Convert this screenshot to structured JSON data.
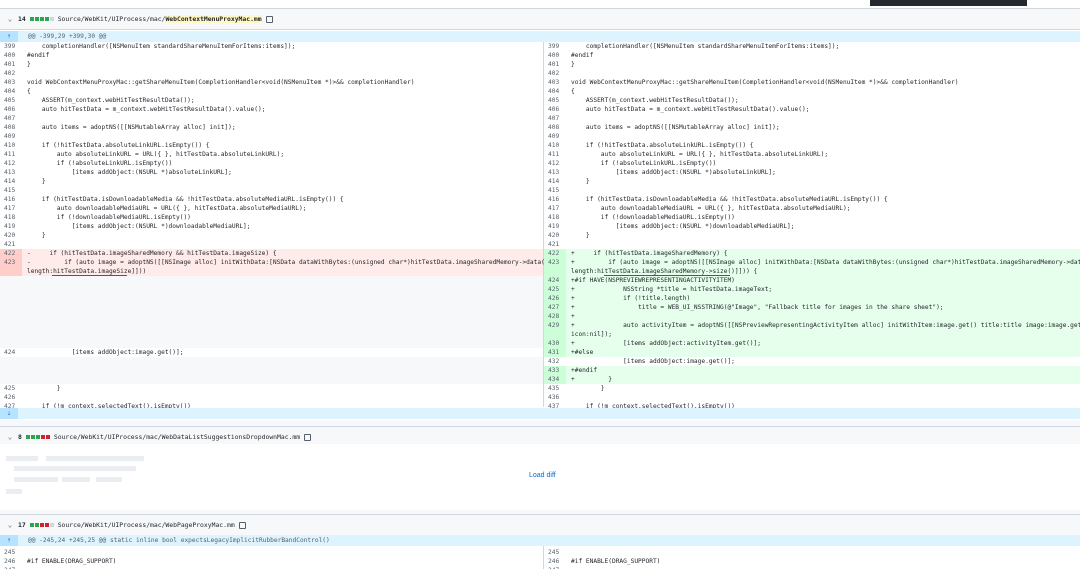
{
  "file1": {
    "count": "14",
    "path_prefix": "Source/WebKit/UIProcess/mac/",
    "path_file": "WebContextMenuProxyMac.mm",
    "hunk": "@@ -399,29 +399,30 @@"
  },
  "left_lines": [
    {
      "n": "399",
      "t": "    completionHandler([NSMenuItem standardShareMenuItemForItems:items]);"
    },
    {
      "n": "400",
      "t": "#endif"
    },
    {
      "n": "401",
      "t": "}"
    },
    {
      "n": "402",
      "t": ""
    },
    {
      "n": "403",
      "t": "void WebContextMenuProxyMac::getShareMenuItem(CompletionHandler<void(NSMenuItem *)>&& completionHandler)"
    },
    {
      "n": "404",
      "t": "{"
    },
    {
      "n": "405",
      "t": "    ASSERT(m_context.webHitTestResultData());"
    },
    {
      "n": "406",
      "t": "    auto hitTestData = m_context.webHitTestResultData().value();"
    },
    {
      "n": "407",
      "t": ""
    },
    {
      "n": "408",
      "t": "    auto items = adoptNS([[NSMutableArray alloc] init]);"
    },
    {
      "n": "409",
      "t": ""
    },
    {
      "n": "410",
      "t": "    if (!hitTestData.absoluteLinkURL.isEmpty()) {"
    },
    {
      "n": "411",
      "t": "        auto absoluteLinkURL = URL({ }, hitTestData.absoluteLinkURL);"
    },
    {
      "n": "412",
      "t": "        if (!absoluteLinkURL.isEmpty())"
    },
    {
      "n": "413",
      "t": "            [items addObject:(NSURL *)absoluteLinkURL];"
    },
    {
      "n": "414",
      "t": "    }"
    },
    {
      "n": "415",
      "t": ""
    },
    {
      "n": "416",
      "t": "    if (hitTestData.isDownloadableMedia && !hitTestData.absoluteMediaURL.isEmpty()) {"
    },
    {
      "n": "417",
      "t": "        auto downloadableMediaURL = URL({ }, hitTestData.absoluteMediaURL);"
    },
    {
      "n": "418",
      "t": "        if (!downloadableMediaURL.isEmpty())"
    },
    {
      "n": "419",
      "t": "            [items addObject:(NSURL *)downloadableMediaURL];"
    },
    {
      "n": "420",
      "t": "    }"
    },
    {
      "n": "421",
      "t": ""
    }
  ],
  "left_del": [
    {
      "n": "422",
      "t": "-     if (hitTestData.imageSharedMemory && hitTestData.imageSize) {"
    },
    {
      "n": "423",
      "t": "-         if (auto image = adoptNS([[NSImage alloc] initWithData:[NSData dataWithBytes:(unsigned char*)hitTestData.imageSharedMemory->data()"
    },
    {
      "n": "",
      "t": "length:hitTestData.imageSize]]))"
    }
  ],
  "left_tail": [
    {
      "n": "424",
      "t": "            [items addObject:image.get()];"
    },
    {
      "n": "425",
      "t": "        }"
    },
    {
      "n": "426",
      "t": ""
    },
    {
      "n": "427",
      "t": "    if (!m_context.selectedText().isEmpty())"
    }
  ],
  "right_lines": [
    {
      "n": "399",
      "t": "    completionHandler([NSMenuItem standardShareMenuItemForItems:items]);"
    },
    {
      "n": "400",
      "t": "#endif"
    },
    {
      "n": "401",
      "t": "}"
    },
    {
      "n": "402",
      "t": ""
    },
    {
      "n": "403",
      "t": "void WebContextMenuProxyMac::getShareMenuItem(CompletionHandler<void(NSMenuItem *)>&& completionHandler)"
    },
    {
      "n": "404",
      "t": "{"
    },
    {
      "n": "405",
      "t": "    ASSERT(m_context.webHitTestResultData());"
    },
    {
      "n": "406",
      "t": "    auto hitTestData = m_context.webHitTestResultData().value();"
    },
    {
      "n": "407",
      "t": ""
    },
    {
      "n": "408",
      "t": "    auto items = adoptNS([[NSMutableArray alloc] init]);"
    },
    {
      "n": "409",
      "t": ""
    },
    {
      "n": "410",
      "t": "    if (!hitTestData.absoluteLinkURL.isEmpty()) {"
    },
    {
      "n": "411",
      "t": "        auto absoluteLinkURL = URL({ }, hitTestData.absoluteLinkURL);"
    },
    {
      "n": "412",
      "t": "        if (!absoluteLinkURL.isEmpty())"
    },
    {
      "n": "413",
      "t": "            [items addObject:(NSURL *)absoluteLinkURL];"
    },
    {
      "n": "414",
      "t": "    }"
    },
    {
      "n": "415",
      "t": ""
    },
    {
      "n": "416",
      "t": "    if (hitTestData.isDownloadableMedia && !hitTestData.absoluteMediaURL.isEmpty()) {"
    },
    {
      "n": "417",
      "t": "        auto downloadableMediaURL = URL({ }, hitTestData.absoluteMediaURL);"
    },
    {
      "n": "418",
      "t": "        if (!downloadableMediaURL.isEmpty())"
    },
    {
      "n": "419",
      "t": "            [items addObject:(NSURL *)downloadableMediaURL];"
    },
    {
      "n": "420",
      "t": "    }"
    },
    {
      "n": "421",
      "t": ""
    }
  ],
  "right_add": [
    {
      "n": "422",
      "t": "+     if (hitTestData.imageSharedMemory) {"
    },
    {
      "n": "423",
      "t": "+         if (auto image = adoptNS([[NSImage alloc] initWithData:[NSData dataWithBytes:(unsigned char*)hitTestData.imageSharedMemory->data()"
    },
    {
      "n": "",
      "t": "length:hitTestData.imageSharedMemory->size()]])) {"
    },
    {
      "n": "424",
      "t": "+#if HAVE(NSPREVIEWREPRESENTINGACTIVITYITEM)"
    },
    {
      "n": "425",
      "t": "+             NSString *title = hitTestData.imageText;"
    },
    {
      "n": "426",
      "t": "+             if (!title.length)"
    },
    {
      "n": "427",
      "t": "+                 title = WEB_UI_NSSTRING(@\"Image\", \"Fallback title for images in the share sheet\");"
    },
    {
      "n": "428",
      "t": "+"
    },
    {
      "n": "429",
      "t": "+             auto activityItem = adoptNS([[NSPreviewRepresentingActivityItem alloc] initWithItem:image.get() title:title image:image.get()"
    },
    {
      "n": "",
      "t": "icon:nil]);"
    },
    {
      "n": "430",
      "t": "+             [items addObject:activityItem.get()];"
    },
    {
      "n": "431",
      "t": "+#else"
    },
    {
      "n": "432",
      "t": "              [items addObject:image.get()];"
    },
    {
      "n": "433",
      "t": "+#endif"
    },
    {
      "n": "434",
      "t": "+         }"
    }
  ],
  "right_tail": [
    {
      "n": "435",
      "t": "        }"
    },
    {
      "n": "436",
      "t": ""
    },
    {
      "n": "437",
      "t": "    if (!m_context.selectedText().isEmpty())"
    }
  ],
  "file2": {
    "count": "8",
    "path": "Source/WebKit/UIProcess/mac/WebDataListSuggestionsDropdownMac.mm",
    "load": "Load diff"
  },
  "file3": {
    "count": "17",
    "path": "Source/WebKit/UIProcess/mac/WebPageProxyMac.mm",
    "hunk": "@@ -245,24 +245,25 @@ static inline bool expectsLegacyImplicitRubberBandControl()",
    "left": [
      {
        "n": "245",
        "t": ""
      },
      {
        "n": "246",
        "t": "#if ENABLE(DRAG_SUPPORT)"
      },
      {
        "n": "247",
        "t": ""
      }
    ],
    "right": [
      {
        "n": "245",
        "t": ""
      },
      {
        "n": "246",
        "t": "#if ENABLE(DRAG_SUPPORT)"
      },
      {
        "n": "247",
        "t": ""
      }
    ]
  }
}
